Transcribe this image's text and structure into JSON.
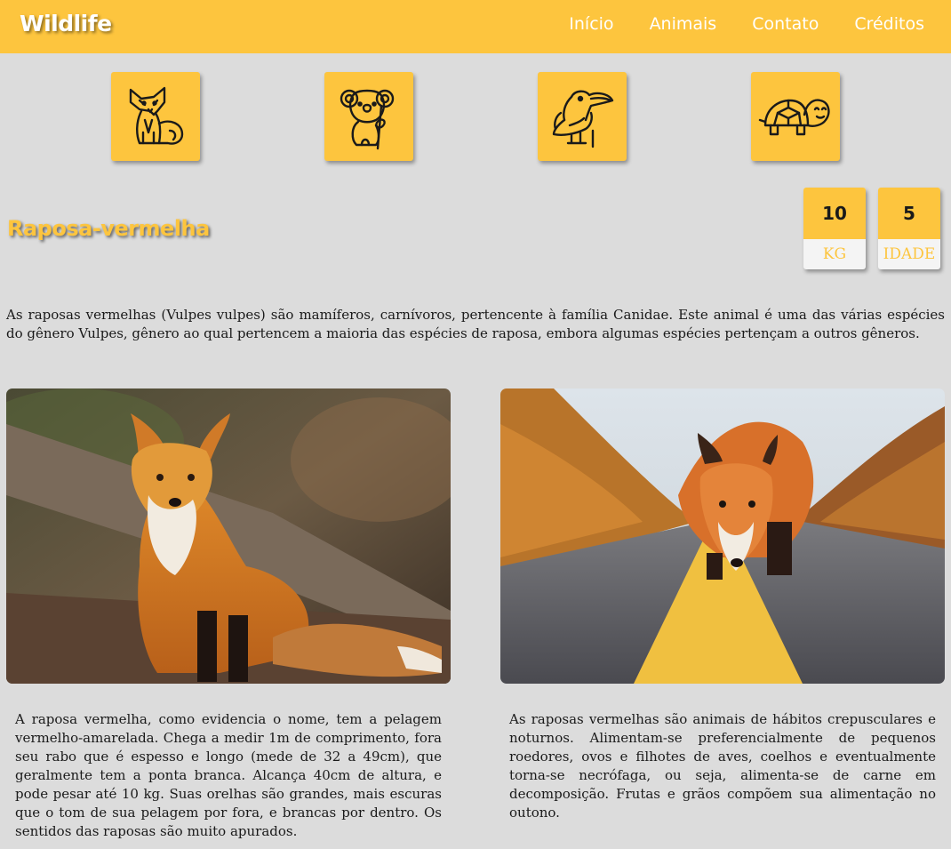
{
  "navbar": {
    "brand": "Wildlife",
    "links": [
      "Início",
      "Animais",
      "Contato",
      "Créditos"
    ]
  },
  "animals": [
    {
      "icon": "fox-icon"
    },
    {
      "icon": "koala-icon"
    },
    {
      "icon": "toucan-icon"
    },
    {
      "icon": "turtle-icon"
    }
  ],
  "animal": {
    "name": "Raposa-vermelha",
    "stats": [
      {
        "value": "10",
        "label": "KG"
      },
      {
        "value": "5",
        "label": "IDADE"
      }
    ],
    "intro": "As raposas vermelhas (Vulpes vulpes) são mamíferos, carnívoros, pertencente à família Canidae. Este animal é uma das várias espécies do gênero Vulpes, gênero ao qual pertencem a maioria das espécies de raposa, embora algumas espécies pertençam a outros gêneros.",
    "description_left": "A raposa vermelha, como evidencia o nome, tem a pelagem vermelho-amarelada. Chega a medir 1m de comprimento, fora seu rabo que é espesso e longo (mede de 32 a 49cm), que geralmente tem a ponta branca. Alcança 40cm de altura, e pode pesar até 10 kg. Suas orelhas são grandes, mais escuras que o tom de sua pelagem por fora, e brancas por dentro. Os sentidos das raposas são muito apurados.",
    "description_right": "As raposas vermelhas são animais de hábitos crepusculares e noturnos. Alimentam-se preferencialmente de pequenos roedores, ovos e filhotes de aves, coelhos e eventualmente torna-se necrófaga, ou seja, alimenta-se de carne em decomposição. Frutas e grãos compõem sua alimentação no outono."
  },
  "theme": {
    "accent": "#fdc53e",
    "background": "#dcdcdc",
    "text": "#1a1a1a"
  }
}
